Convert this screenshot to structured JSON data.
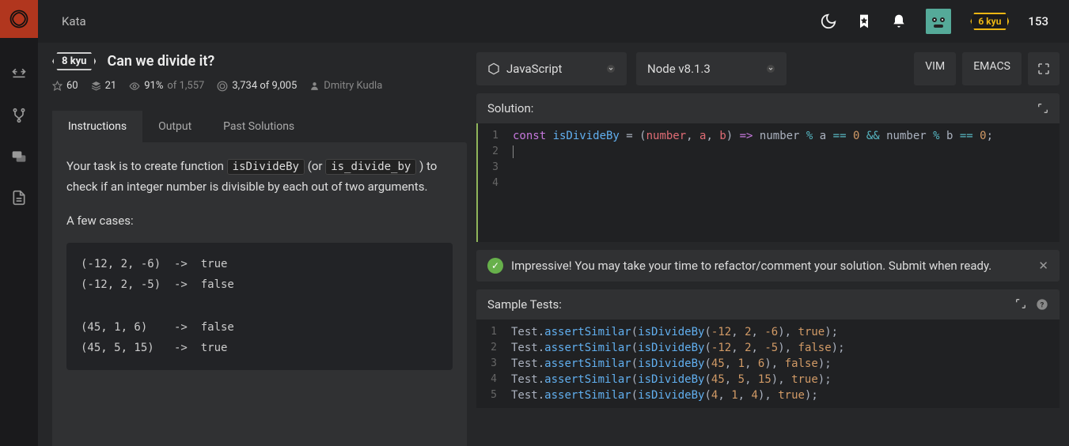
{
  "topbar": {
    "tab": "Kata",
    "user_rank": "6 kyu",
    "honor": "153"
  },
  "kata": {
    "rank": "8 kyu",
    "title": "Can we divide it?",
    "stars": "60",
    "collections": "21",
    "success_pct": "91%",
    "success_of": "of 1,557",
    "completed": "3,734 of 9,005",
    "author": "Dmitry Kudla"
  },
  "tabs": {
    "instructions": "Instructions",
    "output": "Output",
    "past": "Past Solutions"
  },
  "instructions": {
    "text_1": "Your task is to create function ",
    "code_1": "isDivideBy",
    "text_2": " (or ",
    "code_2": "is_divide_by",
    "text_3": " ) to check if an integer number is divisible by each out of two arguments.",
    "text_4": "A few cases:",
    "codeblock": "(-12, 2, -6)  ->  true\n(-12, 2, -5)  ->  false\n\n(45, 1, 6)    ->  false\n(45, 5, 15)   ->  true"
  },
  "dropdowns": {
    "language": "JavaScript",
    "version": "Node v8.1.3"
  },
  "editor": {
    "vim": "VIM",
    "emacs": "EMACS",
    "solution_label": "Solution:",
    "tests_label": "Sample Tests:"
  },
  "solution": {
    "lines": [
      "1",
      "2",
      "3",
      "4"
    ],
    "tokens": [
      {
        "t": "const ",
        "c": "kw"
      },
      {
        "t": "isDivideBy",
        "c": "fn"
      },
      {
        "t": " = (",
        "c": "plain"
      },
      {
        "t": "number",
        "c": "param"
      },
      {
        "t": ", ",
        "c": "plain"
      },
      {
        "t": "a",
        "c": "param"
      },
      {
        "t": ", ",
        "c": "plain"
      },
      {
        "t": "b",
        "c": "param"
      },
      {
        "t": ") ",
        "c": "plain"
      },
      {
        "t": "=>",
        "c": "kw"
      },
      {
        "t": " number ",
        "c": "plain"
      },
      {
        "t": "%",
        "c": "op"
      },
      {
        "t": " a ",
        "c": "plain"
      },
      {
        "t": "==",
        "c": "op"
      },
      {
        "t": " ",
        "c": "plain"
      },
      {
        "t": "0",
        "c": "num"
      },
      {
        "t": " ",
        "c": "plain"
      },
      {
        "t": "&&",
        "c": "op"
      },
      {
        "t": " number ",
        "c": "plain"
      },
      {
        "t": "%",
        "c": "op"
      },
      {
        "t": " b ",
        "c": "plain"
      },
      {
        "t": "==",
        "c": "op"
      },
      {
        "t": " ",
        "c": "plain"
      },
      {
        "t": "0",
        "c": "num"
      },
      {
        "t": ";",
        "c": "plain"
      }
    ]
  },
  "tests": {
    "lines": [
      "1",
      "2",
      "3",
      "4",
      "5"
    ],
    "rows": [
      [
        {
          "t": "Test.",
          "c": "plain"
        },
        {
          "t": "assertSimilar",
          "c": "fn"
        },
        {
          "t": "(",
          "c": "plain"
        },
        {
          "t": "isDivideBy",
          "c": "fn"
        },
        {
          "t": "(",
          "c": "plain"
        },
        {
          "t": "-12",
          "c": "num"
        },
        {
          "t": ", ",
          "c": "plain"
        },
        {
          "t": "2",
          "c": "num"
        },
        {
          "t": ", ",
          "c": "plain"
        },
        {
          "t": "-6",
          "c": "num"
        },
        {
          "t": "), ",
          "c": "plain"
        },
        {
          "t": "true",
          "c": "num"
        },
        {
          "t": ");",
          "c": "plain"
        }
      ],
      [
        {
          "t": "Test.",
          "c": "plain"
        },
        {
          "t": "assertSimilar",
          "c": "fn"
        },
        {
          "t": "(",
          "c": "plain"
        },
        {
          "t": "isDivideBy",
          "c": "fn"
        },
        {
          "t": "(",
          "c": "plain"
        },
        {
          "t": "-12",
          "c": "num"
        },
        {
          "t": ", ",
          "c": "plain"
        },
        {
          "t": "2",
          "c": "num"
        },
        {
          "t": ", ",
          "c": "plain"
        },
        {
          "t": "-5",
          "c": "num"
        },
        {
          "t": "), ",
          "c": "plain"
        },
        {
          "t": "false",
          "c": "num"
        },
        {
          "t": ");",
          "c": "plain"
        }
      ],
      [
        {
          "t": "Test.",
          "c": "plain"
        },
        {
          "t": "assertSimilar",
          "c": "fn"
        },
        {
          "t": "(",
          "c": "plain"
        },
        {
          "t": "isDivideBy",
          "c": "fn"
        },
        {
          "t": "(",
          "c": "plain"
        },
        {
          "t": "45",
          "c": "num"
        },
        {
          "t": ", ",
          "c": "plain"
        },
        {
          "t": "1",
          "c": "num"
        },
        {
          "t": ", ",
          "c": "plain"
        },
        {
          "t": "6",
          "c": "num"
        },
        {
          "t": "), ",
          "c": "plain"
        },
        {
          "t": "false",
          "c": "num"
        },
        {
          "t": ");",
          "c": "plain"
        }
      ],
      [
        {
          "t": "Test.",
          "c": "plain"
        },
        {
          "t": "assertSimilar",
          "c": "fn"
        },
        {
          "t": "(",
          "c": "plain"
        },
        {
          "t": "isDivideBy",
          "c": "fn"
        },
        {
          "t": "(",
          "c": "plain"
        },
        {
          "t": "45",
          "c": "num"
        },
        {
          "t": ", ",
          "c": "plain"
        },
        {
          "t": "5",
          "c": "num"
        },
        {
          "t": ", ",
          "c": "plain"
        },
        {
          "t": "15",
          "c": "num"
        },
        {
          "t": "), ",
          "c": "plain"
        },
        {
          "t": "true",
          "c": "num"
        },
        {
          "t": ");",
          "c": "plain"
        }
      ],
      [
        {
          "t": "Test.",
          "c": "plain"
        },
        {
          "t": "assertSimilar",
          "c": "fn"
        },
        {
          "t": "(",
          "c": "plain"
        },
        {
          "t": "isDivideBy",
          "c": "fn"
        },
        {
          "t": "(",
          "c": "plain"
        },
        {
          "t": "4",
          "c": "num"
        },
        {
          "t": ", ",
          "c": "plain"
        },
        {
          "t": "1",
          "c": "num"
        },
        {
          "t": ", ",
          "c": "plain"
        },
        {
          "t": "4",
          "c": "num"
        },
        {
          "t": "), ",
          "c": "plain"
        },
        {
          "t": "true",
          "c": "num"
        },
        {
          "t": ");",
          "c": "plain"
        }
      ]
    ]
  },
  "success_msg": "Impressive! You may take your time to refactor/comment your solution. Submit when ready."
}
